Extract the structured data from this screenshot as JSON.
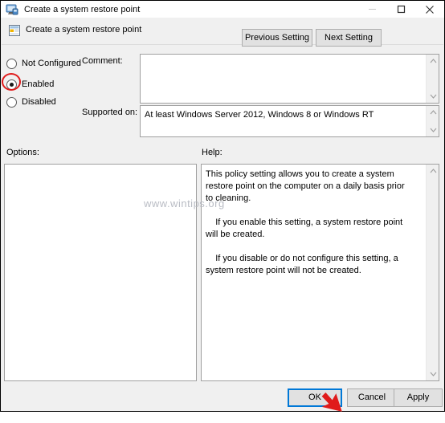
{
  "window": {
    "title": "Create a system restore point",
    "icon": "policy-setting-icon",
    "controls": {
      "minimize": "minimize-icon",
      "maximize": "maximize-icon",
      "close": "close-icon"
    }
  },
  "header": {
    "icon": "policy-setting-icon",
    "title": "Create a system restore point",
    "previous_setting_label": "Previous Setting",
    "next_setting_label": "Next Setting"
  },
  "state": {
    "options": [
      {
        "label": "Not Configured",
        "checked": false
      },
      {
        "label": "Enabled",
        "checked": true
      },
      {
        "label": "Disabled",
        "checked": false
      }
    ],
    "selected": "Enabled"
  },
  "comment": {
    "label": "Comment:",
    "value": "",
    "placeholder": ""
  },
  "supported_on": {
    "label": "Supported on:",
    "value": "At least Windows Server 2012, Windows 8 or Windows RT"
  },
  "options_panel": {
    "label": "Options:",
    "content": ""
  },
  "help_panel": {
    "label": "Help:",
    "text": "This policy setting allows you to create a system restore point on the computer on a daily basis prior to cleaning.\n\n    If you enable this setting, a system restore point will be created.\n\n    If you disable or do not configure this setting, a system restore point will not be created."
  },
  "footer": {
    "ok_label": "OK",
    "cancel_label": "Cancel",
    "apply_label": "Apply",
    "focused_button": "OK"
  },
  "annotations": {
    "highlight_target": "Enabled",
    "highlight_color": "#e01b1b",
    "pointer_target": "OK",
    "pointer_color": "#e01b1b"
  },
  "watermark": {
    "text": "www.wintips.org",
    "color": "#b9bcc4"
  }
}
